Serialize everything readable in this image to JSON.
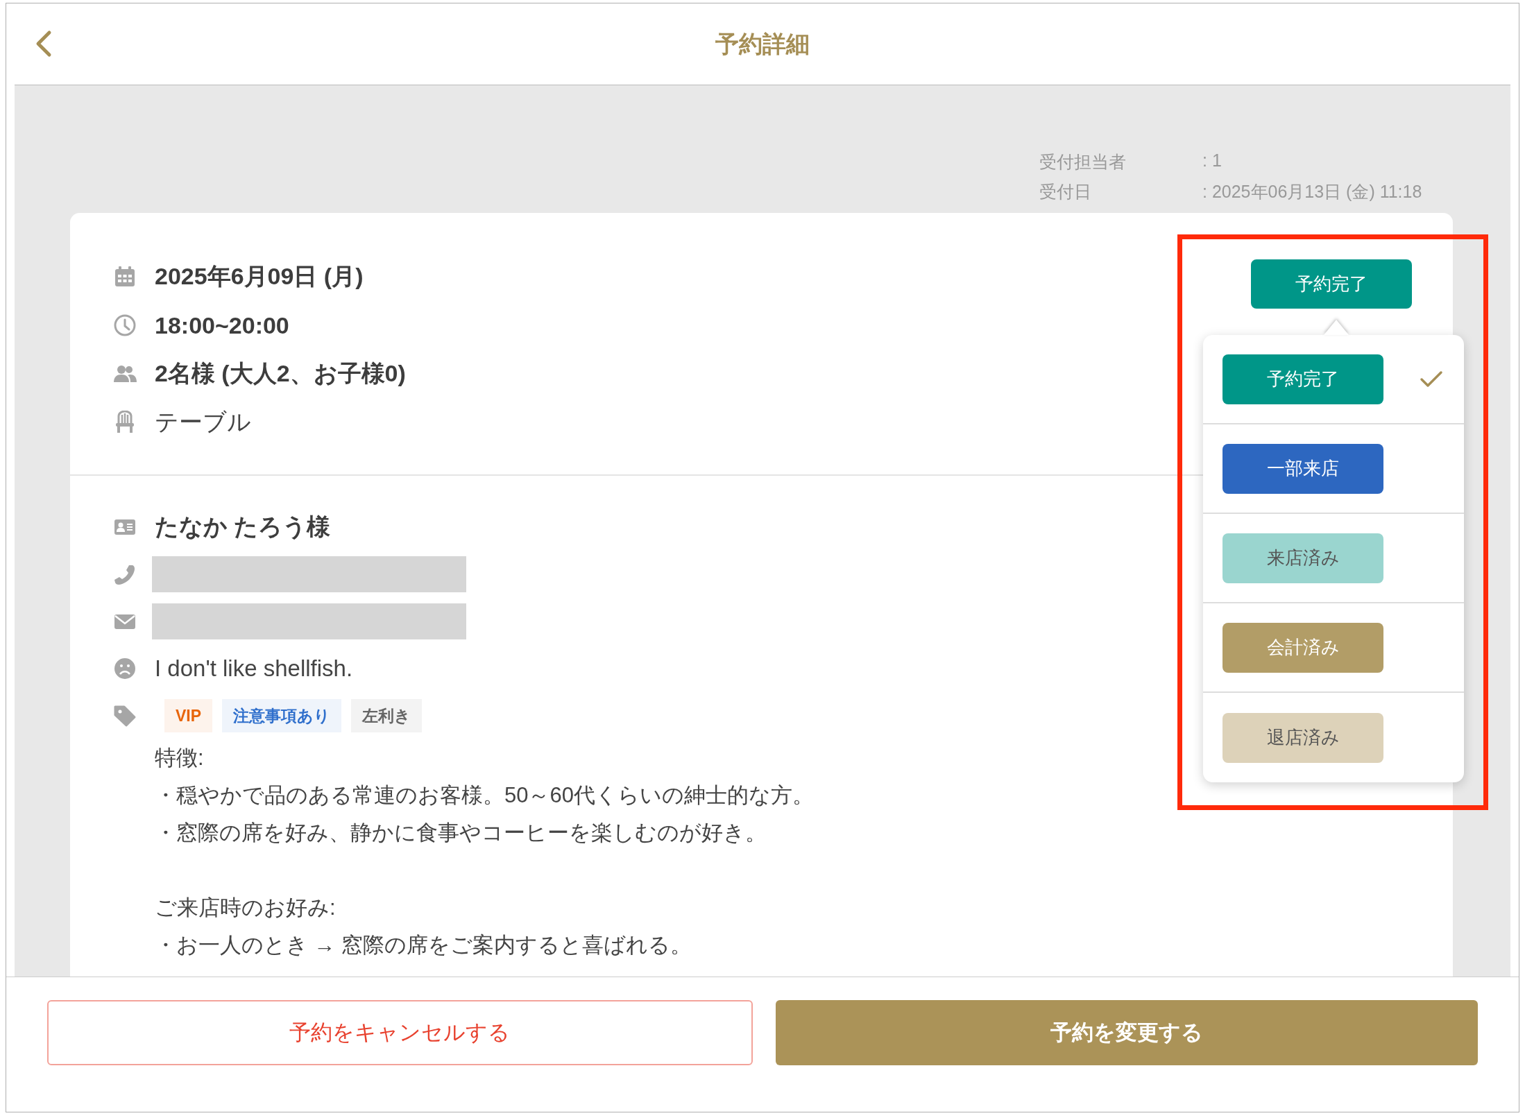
{
  "header": {
    "title": "予約詳細"
  },
  "meta": [
    {
      "label": "受付担当者",
      "value": ": 1"
    },
    {
      "label": "受付日",
      "value": ": 2025年06月13日 (金) 11:18"
    }
  ],
  "reservation": [
    {
      "kind": "date",
      "text": "2025年6月09日 (月)"
    },
    {
      "kind": "time",
      "text": "18:00~20:00"
    },
    {
      "kind": "party",
      "text": "2名様 (大人2、お子様0)"
    },
    {
      "kind": "seat",
      "text": "テーブル"
    }
  ],
  "customer": {
    "name": "たなか たろう様",
    "contacts": [
      {
        "kind": "phone",
        "redacted": true
      },
      {
        "kind": "email",
        "redacted": true
      }
    ],
    "dislike": "I don't like shellfish.",
    "tags": [
      {
        "label": "VIP",
        "color": "#e8650a"
      },
      {
        "label": "注意事項あり",
        "color": "#2f6fcc"
      },
      {
        "label": "左利き",
        "color": "#666666"
      }
    ],
    "notes": [
      {
        "heading": "特徴:",
        "lines": [
          "・穏やかで品のある常連のお客様。50～60代くらいの紳士的な方。",
          "・窓際の席を好み、静かに食事やコーヒーを楽しむのが好き。"
        ]
      },
      {
        "heading": "ご来店時のお好み:",
        "lines": [
          "・お一人のとき → 窓際の席をご案内すると喜ばれる。"
        ]
      }
    ]
  },
  "status": {
    "current": "予約完了",
    "highlight": true,
    "options": [
      {
        "label": "予約完了",
        "color": "#009688",
        "selected": true
      },
      {
        "label": "一部来店",
        "color": "#2d67c0",
        "selected": false
      },
      {
        "label": "来店済み",
        "color": "#9ad5cf",
        "selected": false
      },
      {
        "label": "会計済み",
        "color": "#b29d67",
        "selected": false
      },
      {
        "label": "退店済み",
        "color": "#ddd2b9",
        "selected": false
      }
    ]
  },
  "footer": {
    "buttons": [
      {
        "kind": "secondary",
        "label": "予約をキャンセルする"
      },
      {
        "kind": "primary",
        "label": "予約を変更する"
      }
    ]
  }
}
